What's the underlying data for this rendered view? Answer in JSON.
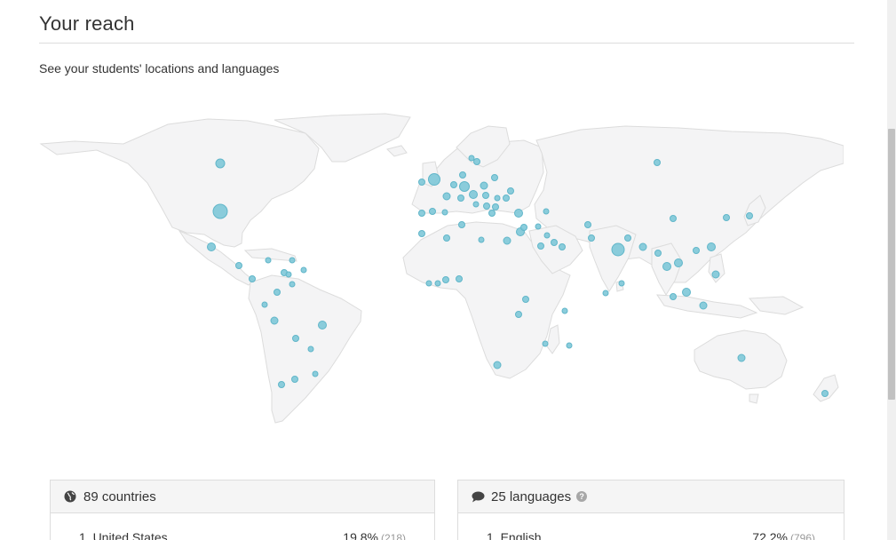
{
  "header": {
    "title": "Your reach",
    "subtitle": "See your students' locations and languages"
  },
  "map": {
    "land_color": "#f4f4f5",
    "land_stroke": "#dcdcdc",
    "marker_color": "#7ec8d8",
    "marker_stroke": "#61b6c9"
  },
  "countries_panel": {
    "icon": "globe-icon",
    "title": "89 countries",
    "rows": [
      {
        "name": "1. United States",
        "percent": "19.8%",
        "count": "(218)"
      }
    ]
  },
  "languages_panel": {
    "icon": "speech-bubble-icon",
    "title": "25 languages",
    "help_icon": "question-icon",
    "help_glyph": "?",
    "rows": [
      {
        "name": "1. English",
        "percent": "72.2%",
        "count": "(796)"
      }
    ]
  }
}
